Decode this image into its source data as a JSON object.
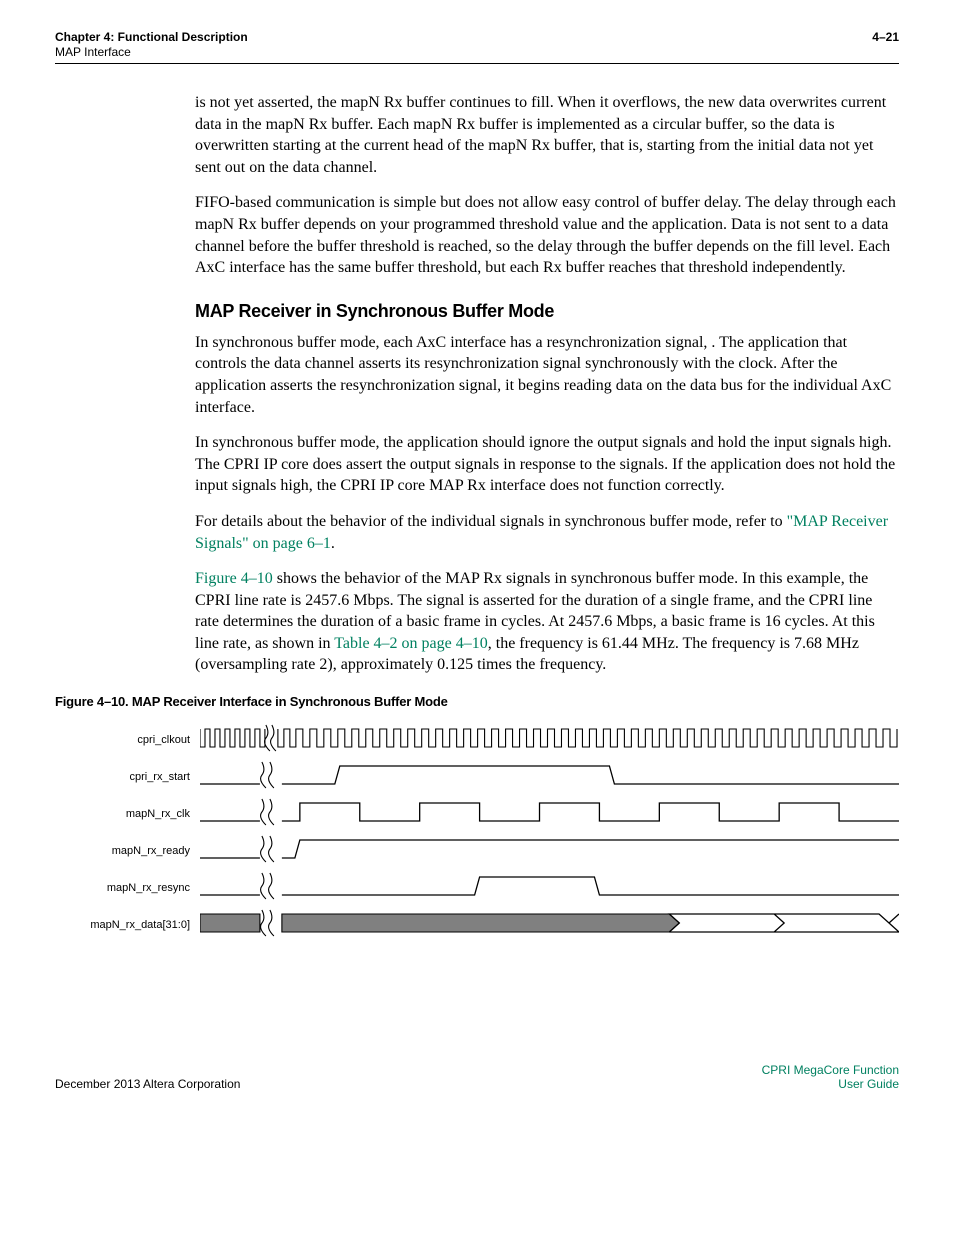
{
  "header": {
    "chapter": "Chapter 4:  Functional Description",
    "subtitle": "MAP Interface",
    "pageno": "4–21"
  },
  "para1": "is not yet asserted, the mapN Rx buffer continues to fill. When it overflows, the new data overwrites current data in the mapN Rx buffer. Each mapN Rx buffer is implemented as a circular buffer, so the data is overwritten starting at the current head of the mapN Rx buffer, that is, starting from the initial data not yet sent out on the data channel.",
  "para2": "FIFO-based communication is simple but does not allow easy control of buffer delay. The delay through each mapN Rx buffer depends on your programmed threshold value and the application. Data is not sent to a data channel before the buffer threshold is reached, so the delay through the buffer depends on the fill level. Each AxC interface has the same buffer threshold, but each Rx buffer reaches that threshold independently.",
  "h2": "MAP Receiver in Synchronous Buffer Mode",
  "para3": "In synchronous buffer mode, each AxC interface has a resynchronization signal, . The application that controls the data channel asserts its resynchronization signal synchronously with the  clock. After the application asserts the resynchronization signal, it begins reading data on the  data bus for the individual AxC interface.",
  "para4": "In synchronous buffer mode, the application should ignore the  output signals and hold the  input signals high. The CPRI IP core does assert the  output signals in response to the  signals. If the application does not hold the  input signals high, the CPRI IP core MAP Rx interface does not function correctly.",
  "para5a": "For details about the behavior of the individual signals in synchronous buffer mode, refer to ",
  "para5link": "\"MAP Receiver Signals\" on page 6–1",
  "para6link1": "Figure 4–10",
  "para6a": " shows the behavior of the MAP Rx signals in synchronous buffer mode. In this example, the CPRI line rate is 2457.6 Mbps. The  signal is asserted for the duration of a single frame, and the CPRI line rate determines the duration of a basic frame in  cycles. At 2457.6 Mbps, a basic frame is 16  cycles. At this line rate, as shown in ",
  "para6link2": "Table 4–2 on page 4–10",
  "para6b": ", the  frequency is 61.44 MHz. The  frequency is 7.68 MHz (oversampling rate 2), approximately 0.125 times the  frequency.",
  "figcap": "Figure 4–10.  MAP Receiver Interface in Synchronous Buffer Mode",
  "timing": {
    "labels": [
      "cpri_clkout",
      "cpri_rx_start",
      "mapN_rx_clk",
      "mapN_rx_ready",
      "mapN_rx_resync",
      "mapN_rx_data[31:0]"
    ]
  },
  "footer": {
    "left": "December 2013   Altera Corporation",
    "right1": "CPRI MegaCore Function",
    "right2": "User Guide"
  }
}
